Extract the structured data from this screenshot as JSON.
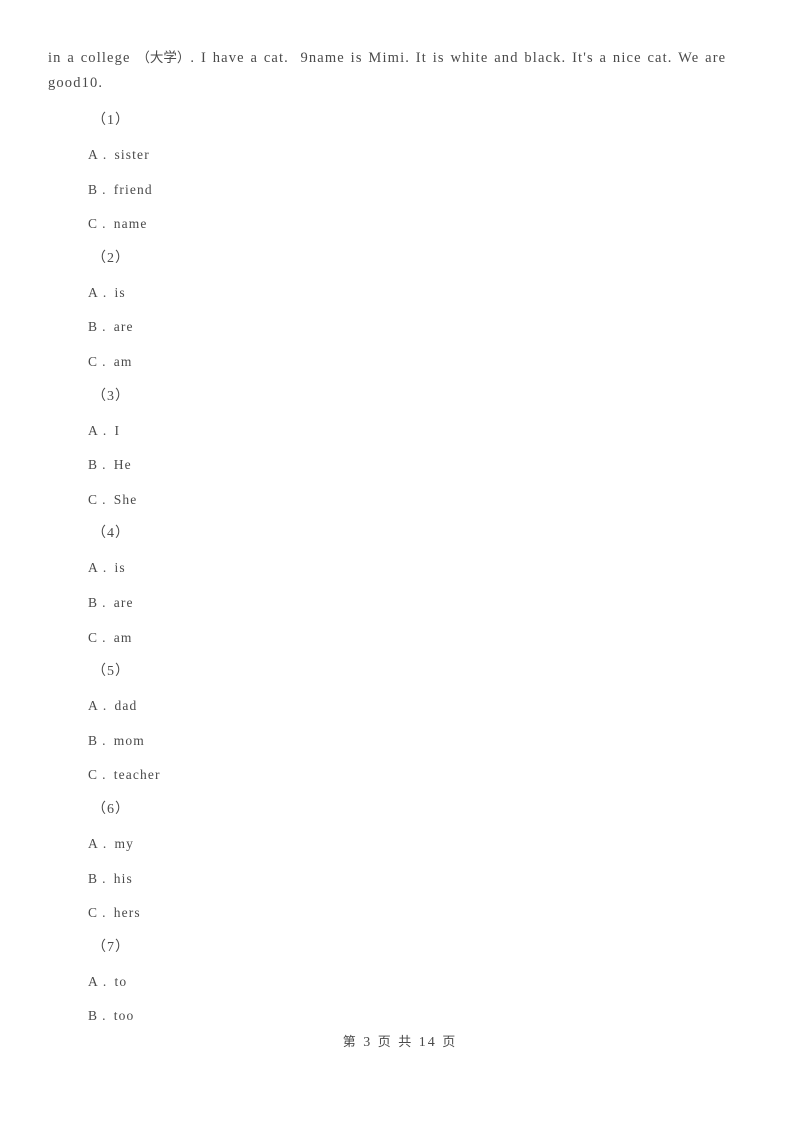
{
  "document": {
    "type": "exam-paper",
    "passage_lines": [
      "in a college (大学). I have a cat.  9name is Mimi. It is white and black. It's a nice cat. We are",
      "good10."
    ],
    "passage_text": "in a college (大学). I have a cat.  9name is Mimi. It is white and black. It's a nice cat. We are good10."
  },
  "questions": [
    {
      "number": "（1）",
      "options": [
        {
          "letter": "A",
          "dot": ".",
          "text": "sister"
        },
        {
          "letter": "B",
          "dot": ".",
          "text": "friend"
        },
        {
          "letter": "C",
          "dot": ".",
          "text": "name"
        }
      ]
    },
    {
      "number": "（2）",
      "options": [
        {
          "letter": "A",
          "dot": ".",
          "text": "is"
        },
        {
          "letter": "B",
          "dot": ".",
          "text": "are"
        },
        {
          "letter": "C",
          "dot": ".",
          "text": "am"
        }
      ]
    },
    {
      "number": "（3）",
      "options": [
        {
          "letter": "A",
          "dot": ".",
          "text": "I"
        },
        {
          "letter": "B",
          "dot": ".",
          "text": "He"
        },
        {
          "letter": "C",
          "dot": ".",
          "text": "She"
        }
      ]
    },
    {
      "number": "（4）",
      "options": [
        {
          "letter": "A",
          "dot": ".",
          "text": "is"
        },
        {
          "letter": "B",
          "dot": ".",
          "text": "are"
        },
        {
          "letter": "C",
          "dot": ".",
          "text": "am"
        }
      ]
    },
    {
      "number": "（5）",
      "options": [
        {
          "letter": "A",
          "dot": ".",
          "text": "dad"
        },
        {
          "letter": "B",
          "dot": ".",
          "text": "mom"
        },
        {
          "letter": "C",
          "dot": ".",
          "text": "teacher"
        }
      ]
    },
    {
      "number": "（6）",
      "options": [
        {
          "letter": "A",
          "dot": ".",
          "text": "my"
        },
        {
          "letter": "B",
          "dot": ".",
          "text": "his"
        },
        {
          "letter": "C",
          "dot": ".",
          "text": "hers"
        }
      ]
    },
    {
      "number": "（7）",
      "options": [
        {
          "letter": "A",
          "dot": ".",
          "text": "to"
        },
        {
          "letter": "B",
          "dot": ".",
          "text": "too"
        }
      ]
    }
  ],
  "footer": {
    "prefix": "第",
    "current_page": "3",
    "page_unit": "页",
    "conjunction": "共",
    "total_pages": "14",
    "total_unit": "页",
    "full_text": "第 3 页 共 14 页"
  },
  "colors": {
    "page_background": "#ffffff",
    "body_text": "#4a4a4a"
  }
}
